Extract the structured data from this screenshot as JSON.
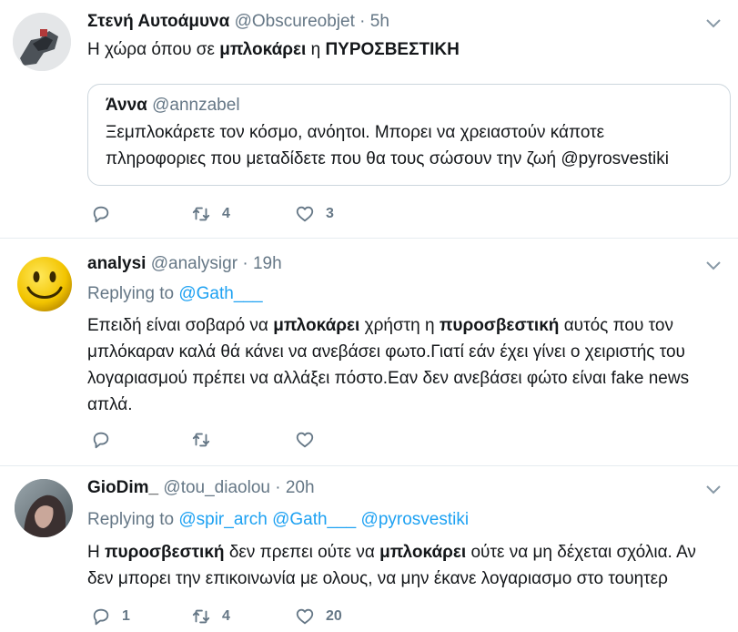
{
  "tweets": [
    {
      "name": "Στενή Αυτοάμυνα",
      "handle": "@Obscureobjet",
      "dot": "·",
      "time": "5h",
      "text": {
        "p1": "Η χώρα όπου σε ",
        "b1": "μπλοκάρει",
        "p2": " η ",
        "b2": "ΠΥΡΟΣΒΕΣΤΙΚΗ"
      },
      "quote": {
        "name": "Άννα",
        "handle": "@annzabel",
        "line1": "Ξεμπλοκάρετε τον κόσμο, ανόητοι. Μπορει να χρειαστούν κάποτε",
        "line2": "πληροφοριες που μεταδίδετε που θα τους σώσουν την ζωή @pyrosvestiki"
      },
      "actions": {
        "reply_count": "",
        "retweet_count": "4",
        "like_count": "3"
      }
    },
    {
      "name": "analysi",
      "handle": "@analysigr",
      "dot": "·",
      "time": "19h",
      "replying_prefix": "Replying to",
      "replying_to": [
        "@Gath___"
      ],
      "text": {
        "p1": "Επειδή είναι σοβαρό να ",
        "b1": "μπλοκάρει",
        "p2": " χρήστη η ",
        "b2": "πυροσβεστική",
        "p3": " αυτός που τον",
        "line2": "μπλόκαραν καλά θά κάνει να ανεβάσει φωτο.Γιατί εάν έχει γίνει ο χειριστής του",
        "line3": "λογαριασμού πρέπει να αλλάξει πόστο.Εαν δεν ανεβάσει φώτο είναι fake news",
        "line4": "απλά."
      },
      "actions": {
        "reply_count": "",
        "retweet_count": "",
        "like_count": ""
      }
    },
    {
      "name": "GioDim_",
      "handle": "@tou_diaolou",
      "dot": "·",
      "time": "20h",
      "replying_prefix": "Replying to",
      "replying_to": [
        "@spir_arch",
        "@Gath___",
        "@pyrosvestiki"
      ],
      "text": {
        "p1": "Η ",
        "b1": "πυροσβεστική",
        "p2": " δεν πρεπει ούτε να ",
        "b2": "μπλοκάρει",
        "p3": " ούτε να μη δέχεται σχόλια. Αν",
        "line2": "δεν μπορει την επικοινωνία με ολους, να μην έκανε λογαριασμο στο τουητερ"
      },
      "actions": {
        "reply_count": "1",
        "retweet_count": "4",
        "like_count": "20"
      }
    }
  ],
  "colors": {
    "link": "#1da1f2",
    "muted": "#657786",
    "border": "#e6ecf0"
  },
  "icons": [
    "reply-icon",
    "retweet-icon",
    "like-icon",
    "chevron-down-icon"
  ]
}
